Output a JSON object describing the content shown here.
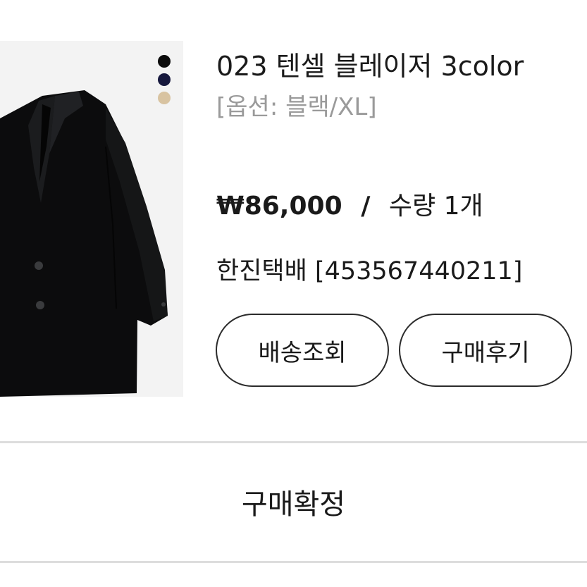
{
  "product": {
    "title": "023 텐셀 블레이저 3color",
    "option": "[옵션: 블랙/XL]",
    "price": "₩86,000",
    "separator": "/",
    "quantity": "수량 1개",
    "image_icon": "blazer-image",
    "colors": [
      "#0b0b0b",
      "#16183d",
      "#d8c3a1"
    ]
  },
  "shipping": {
    "courier_info": "한진택배 [453567440211]"
  },
  "actions": {
    "track_label": "배송조회",
    "review_label": "구매후기",
    "confirm_label": "구매확정"
  }
}
